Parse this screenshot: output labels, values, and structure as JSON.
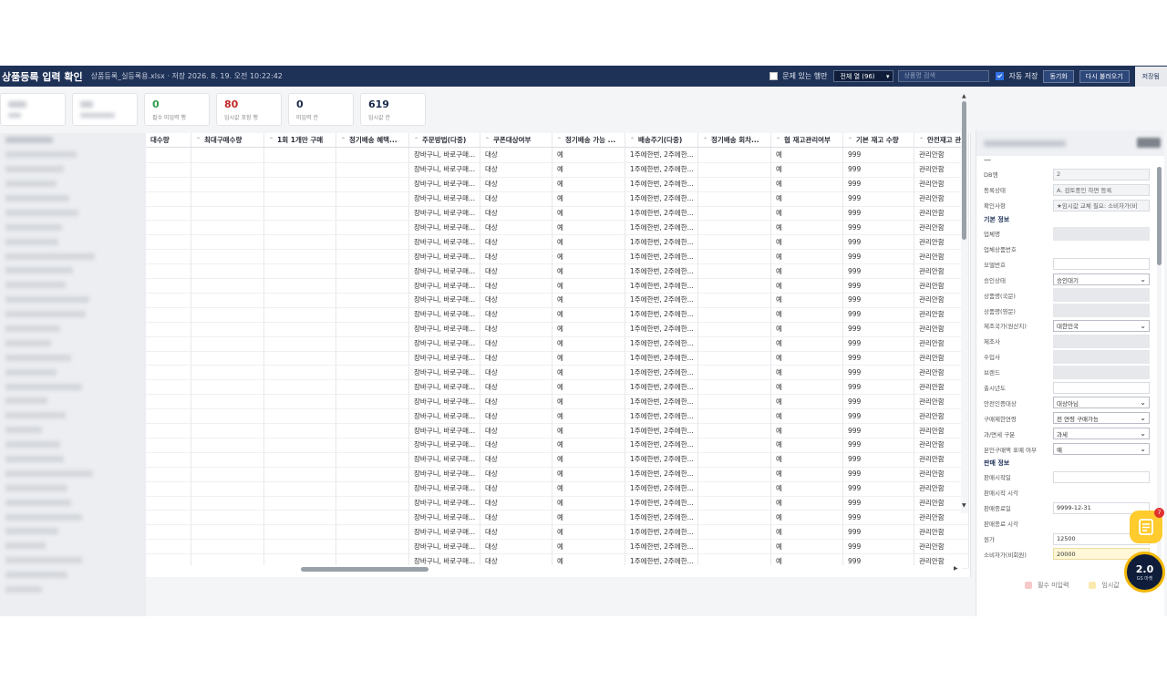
{
  "topbar": {
    "title": "상품등록 입력 확인",
    "subtitle": "상품등록_실등록용.xlsx · 저장 2026. 8. 19. 오전 10:22:42",
    "problem_rows_label": "문제 있는 행만",
    "column_filter": "전체 열 (96)",
    "search_placeholder": "상품명 검색",
    "autosave_label": "자동 저장",
    "sync_label": "동기화",
    "reload_label": "다시 불러오기",
    "save_label": "저장됨"
  },
  "cards": [
    {
      "num": "0",
      "label": "필수 미입력 행",
      "color": "green"
    },
    {
      "num": "80",
      "label": "임시값 포함 행",
      "color": "red"
    },
    {
      "num": "0",
      "label": "미입력 칸",
      "color": "navy"
    },
    {
      "num": "619",
      "label": "임시값 칸",
      "color": "navy"
    }
  ],
  "grid": {
    "headers": [
      "대수량",
      "최대구매수량",
      "1회 1개만 구매",
      "정기배송 혜택...",
      "주문방법(다중)",
      "쿠폰대상여부",
      "정기배송 가능 ...",
      "배송주기(다중)",
      "정기배송 회차...",
      "협 재고관리여부",
      "기본 재고 수량",
      "안전재고 관리"
    ],
    "row_template": [
      "",
      "",
      "",
      "",
      "장바구니, 바로구매...",
      "대상",
      "예",
      "1주에한번, 2주에한...",
      "",
      "예",
      "999",
      "관리안함"
    ],
    "row_count": 29
  },
  "panel": {
    "fields_top": [
      {
        "label": "DB행",
        "value": "2",
        "type": "ro"
      },
      {
        "label": "등록상태",
        "value": "A. 검토중인 하면 등록",
        "type": "ro"
      },
      {
        "label": "확인사항",
        "value": "★임시값 교체 필요: 소비자가(비",
        "type": "ro"
      }
    ],
    "section_basic": "기본 정보",
    "fields_basic": [
      {
        "label": "업체명",
        "value": "",
        "type": "gray"
      },
      {
        "label": "업체상품번호",
        "value": "",
        "type": "blank"
      },
      {
        "label": "모델번호",
        "value": "",
        "type": "plain"
      },
      {
        "label": "승인상태",
        "value": "승인대기",
        "type": "sel"
      },
      {
        "label": "상품명(국문)",
        "value": "",
        "type": "gray"
      },
      {
        "label": "상품명(영문)",
        "value": "",
        "type": "gray"
      },
      {
        "label": "제조국가(원산지)",
        "value": "대한민국",
        "type": "sel"
      },
      {
        "label": "제조사",
        "value": "",
        "type": "gray"
      },
      {
        "label": "수입사",
        "value": "",
        "type": "gray"
      },
      {
        "label": "브랜드",
        "value": "",
        "type": "gray"
      },
      {
        "label": "출시년도",
        "value": "",
        "type": "plain"
      },
      {
        "label": "안전인증대상",
        "value": "대상아님",
        "type": "sel"
      },
      {
        "label": "구매제한연령",
        "value": "전 연령 구매가능",
        "type": "sel"
      },
      {
        "label": "과/면세 구분",
        "value": "과세",
        "type": "sel"
      },
      {
        "label": "본인구매액 표예 여부",
        "value": "예",
        "type": "sel"
      }
    ],
    "section_sales": "판매 정보",
    "fields_sales": [
      {
        "label": "판매시작일",
        "value": "",
        "type": "plain"
      },
      {
        "label": "판매시작 시각",
        "value": "",
        "type": "blank"
      },
      {
        "label": "판매종료일",
        "value": "9999-12-31",
        "type": "plain"
      },
      {
        "label": "판매종료 시각",
        "value": "",
        "type": "blank"
      },
      {
        "label": "원가",
        "value": "12500",
        "type": "plain"
      },
      {
        "label": "소비자가(비회원)",
        "value": "20000",
        "type": "yellow"
      }
    ]
  },
  "legend": {
    "required": "필수 미입력",
    "temp": "임시값"
  },
  "fab": {
    "badge": "7",
    "version": "2.0",
    "version_sub": "GS 마켓"
  },
  "colors": {
    "navy": "#1e3157",
    "green": "#2e9d4a",
    "red": "#c02727",
    "required_swatch": "#f6c9c9",
    "temp_swatch": "#fbeab0"
  }
}
